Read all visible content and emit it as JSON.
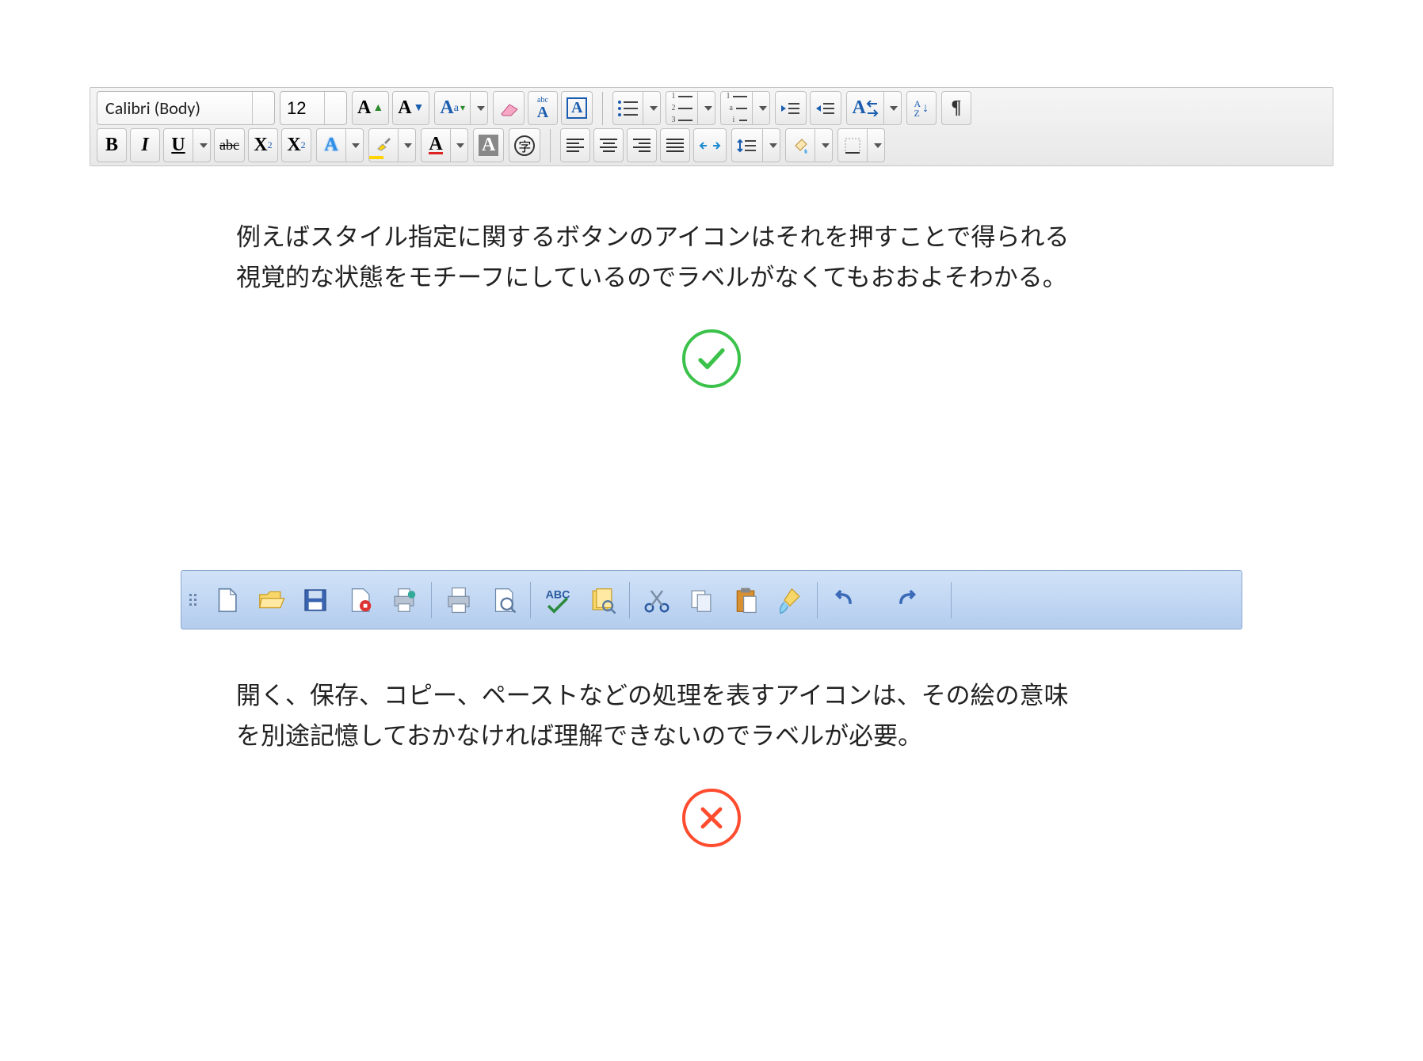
{
  "toolbar1": {
    "font_name": "Calibri (Body)",
    "font_size": "12",
    "row1_right": {
      "bullets": "bullet-list",
      "numbers": "number-list",
      "multilevel": "multilevel-list",
      "outdent": "decrease-indent",
      "indent": "increase-indent",
      "char_scale": "char-width",
      "sort": "sort-az",
      "pilcrow": "¶"
    },
    "row2": {
      "bold": "B",
      "italic": "I",
      "underline": "U",
      "strike": "abc",
      "subscript": "X",
      "sub_sub": "2",
      "superscript": "X",
      "sup_sup": "2",
      "char_effects": "A",
      "highlight": "A",
      "font_color": "A",
      "char_shading": "A",
      "char_circle": "字"
    },
    "row2_right": {
      "line_spacing": "line-spacing",
      "shading": "shading",
      "borders": "borders"
    }
  },
  "para1_line1": "例えばスタイル指定に関するボタンのアイコンはそれを押すことで得られる",
  "para1_line2": "視覚的な状態をモチーフにしているのでラベルがなくてもおおよそわかる。",
  "para2_line1": "開く、保存、コピー、ペーストなどの処理を表すアイコンは、その絵の意味",
  "para2_line2": "を別途記憶しておかなければ理解できないのでラベルが必要。",
  "toolbar2": {
    "icons": [
      "new-document",
      "open-folder",
      "save",
      "save-as",
      "print-quick",
      "print",
      "print-preview",
      "spellcheck",
      "research",
      "cut",
      "copy",
      "paste",
      "format-painter",
      "undo",
      "redo"
    ]
  }
}
